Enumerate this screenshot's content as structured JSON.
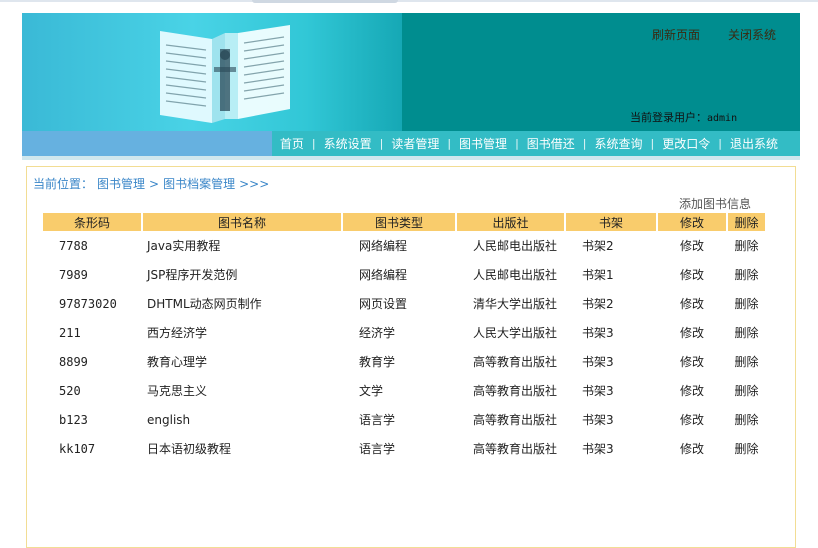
{
  "header": {
    "refresh_label": "刷新页面",
    "close_label": "关闭系统",
    "login_label": "当前登录用户：",
    "login_user": "admin"
  },
  "nav": {
    "items": [
      "首页",
      "系统设置",
      "读者管理",
      "图书管理",
      "图书借还",
      "系统查询",
      "更改口令",
      "退出系统"
    ]
  },
  "breadcrumb": {
    "prefix": "当前位置：",
    "level1": "图书管理",
    "sep": ">",
    "level2": "图书档案管理",
    "trail": ">>>"
  },
  "actions": {
    "add_label": "添加图书信息"
  },
  "table": {
    "headers": [
      "条形码",
      "图书名称",
      "图书类型",
      "出版社",
      "书架",
      "修改",
      "删除"
    ],
    "rows": [
      {
        "code": "7788",
        "name": "Java实用教程",
        "type": "网络编程",
        "publisher": "人民邮电出版社",
        "shelf": "书架2",
        "edit": "修改",
        "del": "删除"
      },
      {
        "code": "7989",
        "name": "JSP程序开发范例",
        "type": "网络编程",
        "publisher": "人民邮电出版社",
        "shelf": "书架1",
        "edit": "修改",
        "del": "删除"
      },
      {
        "code": "97873020",
        "name": "DHTML动态网页制作",
        "type": "网页设置",
        "publisher": "清华大学出版社",
        "shelf": "书架2",
        "edit": "修改",
        "del": "删除"
      },
      {
        "code": "211",
        "name": "西方经济学",
        "type": "经济学",
        "publisher": "人民大学出版社",
        "shelf": "书架3",
        "edit": "修改",
        "del": "删除"
      },
      {
        "code": "8899",
        "name": "教育心理学",
        "type": "教育学",
        "publisher": "高等教育出版社",
        "shelf": "书架3",
        "edit": "修改",
        "del": "删除"
      },
      {
        "code": "520",
        "name": "马克思主义",
        "type": "文学",
        "publisher": "高等教育出版社",
        "shelf": "书架3",
        "edit": "修改",
        "del": "删除"
      },
      {
        "code": "b123",
        "name": "english",
        "type": "语言学",
        "publisher": "高等教育出版社",
        "shelf": "书架3",
        "edit": "修改",
        "del": "删除"
      },
      {
        "code": "kk107",
        "name": "日本语初级教程",
        "type": "语言学",
        "publisher": "高等教育出版社",
        "shelf": "书架3",
        "edit": "修改",
        "del": "删除"
      }
    ]
  },
  "colors": {
    "banner_teal": "#008d8f",
    "nav_teal": "#33bcc5",
    "nav_blue": "#66b1e0",
    "header_row": "#f9cc6c",
    "breadcrumb": "#3a86c8"
  }
}
